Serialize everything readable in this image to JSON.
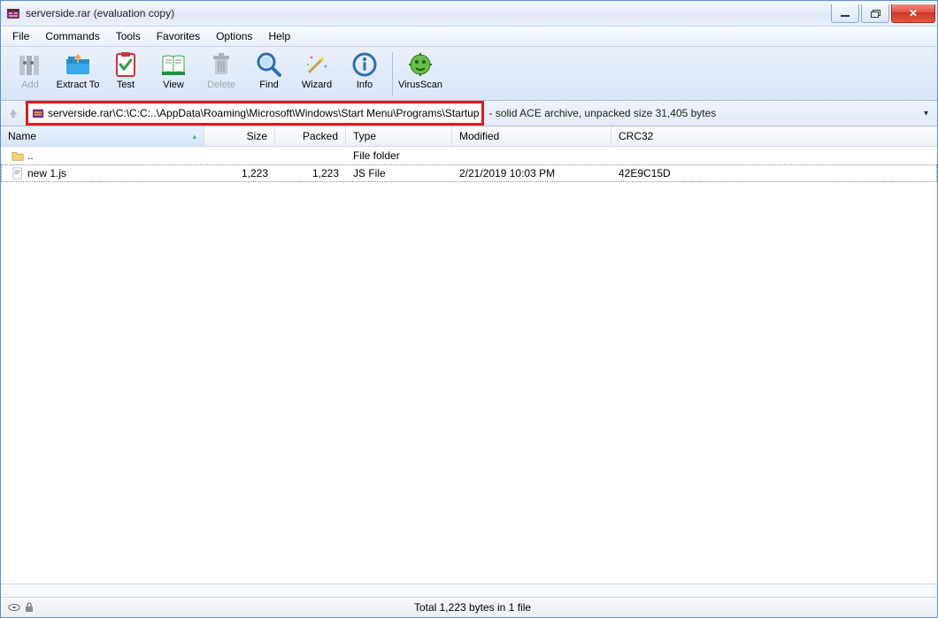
{
  "window": {
    "title": "serverside.rar (evaluation copy)"
  },
  "menu": {
    "items": [
      "File",
      "Commands",
      "Tools",
      "Favorites",
      "Options",
      "Help"
    ]
  },
  "toolbar": {
    "add": "Add",
    "extract": "Extract To",
    "test": "Test",
    "view": "View",
    "delete": "Delete",
    "find": "Find",
    "wizard": "Wizard",
    "info": "Info",
    "virusscan": "VirusScan"
  },
  "address": {
    "path": "serverside.rar\\C:\\C:C:..\\AppData\\Roaming\\Microsoft\\Windows\\Start Menu\\Programs\\Startup",
    "archive_info": "- solid ACE archive, unpacked size 31,405 bytes"
  },
  "columns": {
    "name": "Name",
    "size": "Size",
    "packed": "Packed",
    "type": "Type",
    "modified": "Modified",
    "crc": "CRC32"
  },
  "rows": [
    {
      "name": "..",
      "size": "",
      "packed": "",
      "type": "File folder",
      "modified": "",
      "crc": "",
      "icon": "folder"
    },
    {
      "name": "new 1.js",
      "size": "1,223",
      "packed": "1,223",
      "type": "JS File",
      "modified": "2/21/2019 10:03 PM",
      "crc": "42E9C15D",
      "icon": "js"
    }
  ],
  "status": {
    "center": "Total 1,223 bytes in 1 file"
  }
}
